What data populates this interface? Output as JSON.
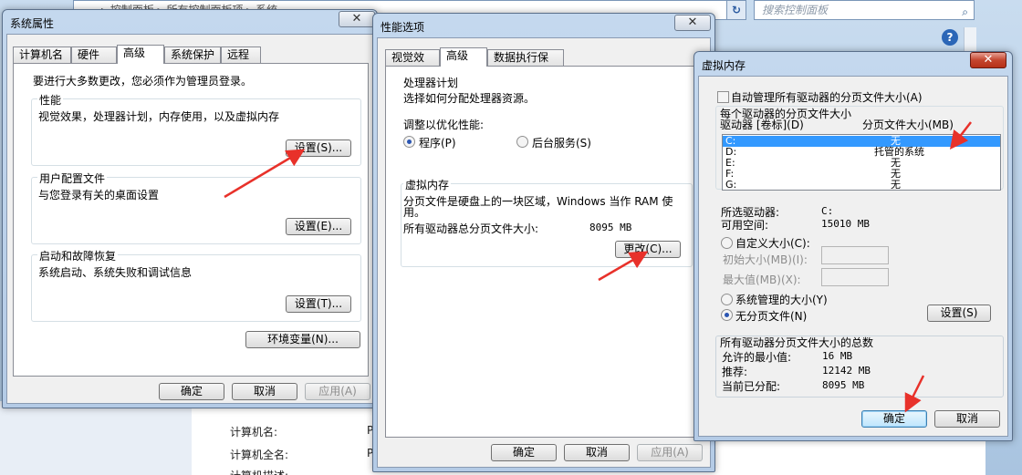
{
  "background": {
    "address_text": "▸ 控制面板 ▸ 所有控制面板项 ▸ 系统",
    "search_placeholder": "搜索控制面板",
    "rows": [
      {
        "label": "计算机名:",
        "value": "P"
      },
      {
        "label": "计算机全名:",
        "value": "P"
      },
      {
        "label": "计算机描述:",
        "value": ""
      }
    ]
  },
  "system_props": {
    "title": "系统属性",
    "close": "✕",
    "tabs": [
      "计算机名",
      "硬件",
      "高级",
      "系统保护",
      "远程"
    ],
    "admin_note": "要进行大多数更改，您必须作为管理员登录。",
    "performance": {
      "label": "性能",
      "desc": "视觉效果，处理器计划，内存使用，以及虚拟内存",
      "button": "设置(S)..."
    },
    "profile": {
      "label": "用户配置文件",
      "desc": "与您登录有关的桌面设置",
      "button": "设置(E)..."
    },
    "startup": {
      "label": "启动和故障恢复",
      "desc": "系统启动、系统失败和调试信息",
      "button": "设置(T)..."
    },
    "env_button": "环境变量(N)...",
    "ok": "确定",
    "cancel": "取消",
    "apply": "应用(A)"
  },
  "perf_options": {
    "title": "性能选项",
    "close": "✕",
    "tabs": [
      "视觉效果",
      "高级",
      "数据执行保护"
    ],
    "cpu": {
      "label": "处理器计划",
      "desc": "选择如何分配处理器资源。",
      "adjust": "调整以优化性能:",
      "program": "程序(P)",
      "background": "后台服务(S)"
    },
    "vm": {
      "label": "虚拟内存",
      "desc1": "分页文件是硬盘上的一块区域，Windows 当作 RAM 使",
      "desc2": "用。",
      "total_label": "所有驱动器总分页文件大小:",
      "total_value": "8095 MB",
      "change": "更改(C)..."
    },
    "ok": "确定",
    "cancel": "取消",
    "apply": "应用(A)"
  },
  "virtual_memory": {
    "title": "虚拟内存",
    "close": "✕",
    "auto_manage": "自动管理所有驱动器的分页文件大小(A)",
    "per_drive": "每个驱动器的分页文件大小",
    "col_drive": "驱动器 [卷标](D)",
    "col_size": "分页文件大小(MB)",
    "drives": [
      {
        "drive": "C:",
        "size": "无"
      },
      {
        "drive": "D:",
        "size": "托管的系统"
      },
      {
        "drive": "E:",
        "size": "无"
      },
      {
        "drive": "F:",
        "size": "无"
      },
      {
        "drive": "G:",
        "size": "无"
      }
    ],
    "selected_label": "所选驱动器:",
    "selected_value": "C:",
    "free_label": "可用空间:",
    "free_value": "15010 MB",
    "custom_size": "自定义大小(C):",
    "initial_size": "初始大小(MB)(I):",
    "max_size": "最大值(MB)(X):",
    "system_managed": "系统管理的大小(Y)",
    "no_paging": "无分页文件(N)",
    "set_button": "设置(S)",
    "totals_label": "所有驱动器分页文件大小的总数",
    "min_label": "允许的最小值:",
    "min_value": "16 MB",
    "rec_label": "推荐:",
    "rec_value": "12142 MB",
    "cur_label": "当前已分配:",
    "cur_value": "8095 MB",
    "ok": "确定",
    "cancel": "取消"
  },
  "colors": {
    "annotation_arrow": "#e8312a",
    "selection": "#3399ff"
  }
}
